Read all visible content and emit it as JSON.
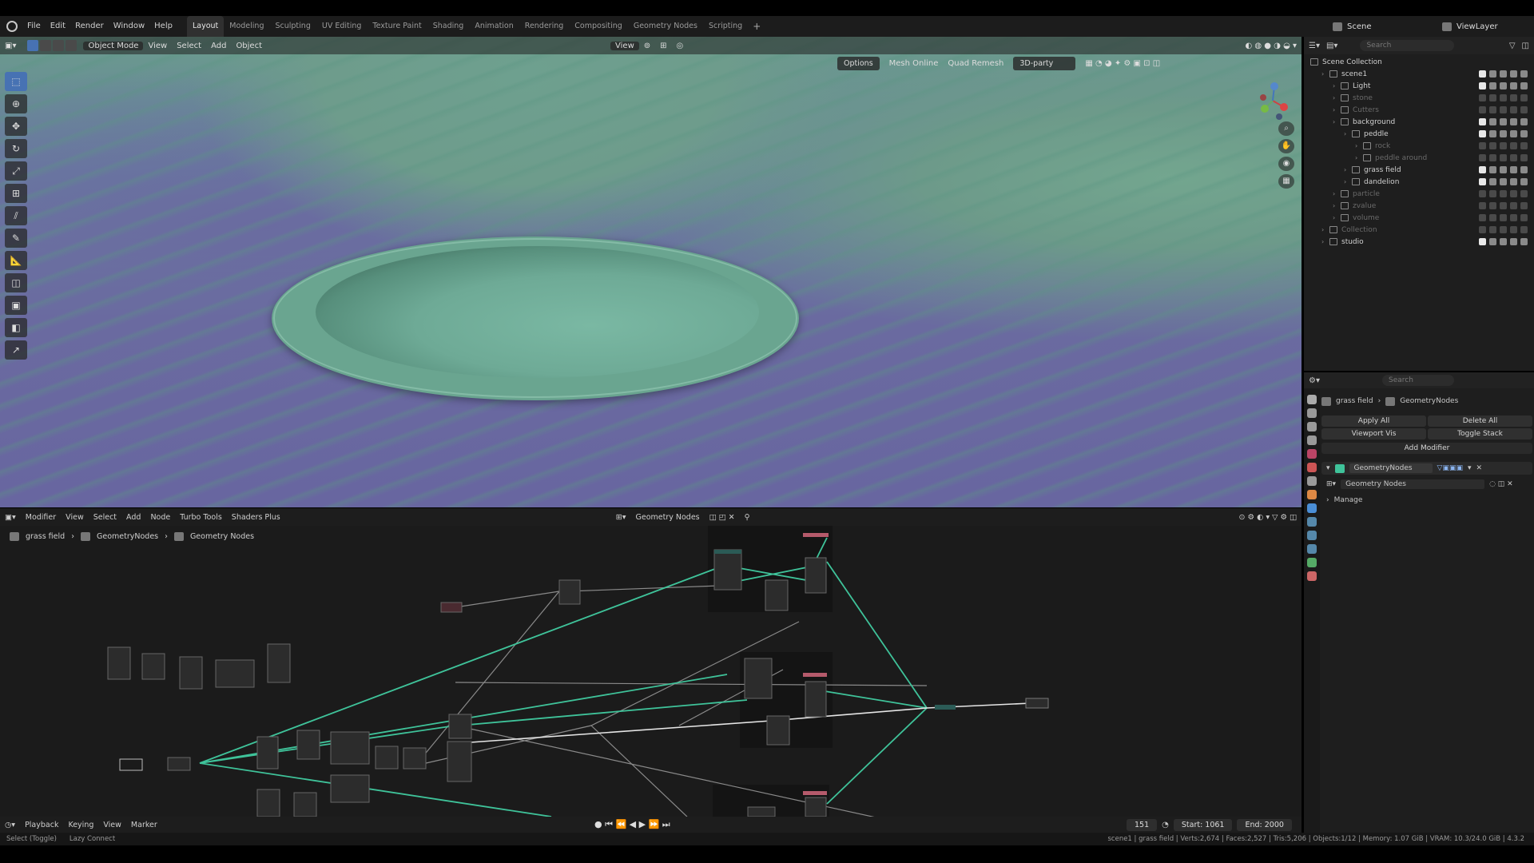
{
  "menubar": {
    "menus": [
      "File",
      "Edit",
      "Render",
      "Window",
      "Help"
    ],
    "workspaces": [
      "Layout",
      "Modeling",
      "Sculpting",
      "UV Editing",
      "Texture Paint",
      "Shading",
      "Animation",
      "Rendering",
      "Compositing",
      "Geometry Nodes",
      "Scripting"
    ],
    "active_workspace": "Layout",
    "scene": "Scene",
    "view_layer": "ViewLayer"
  },
  "viewport": {
    "mode": "Object Mode",
    "menus": [
      "View",
      "Select",
      "Add",
      "Object"
    ],
    "transform_orientation": "View",
    "options": "Options",
    "mesh_online": "Mesh Online",
    "quad_remesh": "Quad Remesh",
    "third_party": "3D-party"
  },
  "outliner": {
    "search_placeholder": "Search",
    "root": "Scene Collection",
    "rows": [
      {
        "label": "scene1",
        "indent": 1,
        "dim": false
      },
      {
        "label": "Light",
        "indent": 2,
        "dim": false
      },
      {
        "label": "stone",
        "indent": 2,
        "dim": true
      },
      {
        "label": "Cutters",
        "indent": 2,
        "dim": true
      },
      {
        "label": "background",
        "indent": 2,
        "dim": false
      },
      {
        "label": "peddle",
        "indent": 3,
        "dim": false
      },
      {
        "label": "rock",
        "indent": 4,
        "dim": true
      },
      {
        "label": "peddle around",
        "indent": 4,
        "dim": true
      },
      {
        "label": "grass field",
        "indent": 3,
        "dim": false
      },
      {
        "label": "dandelion",
        "indent": 3,
        "dim": false
      },
      {
        "label": "particle",
        "indent": 2,
        "dim": true
      },
      {
        "label": "zvalue",
        "indent": 2,
        "dim": true
      },
      {
        "label": "volume",
        "indent": 2,
        "dim": true
      },
      {
        "label": "Collection",
        "indent": 1,
        "dim": true
      },
      {
        "label": "studio",
        "indent": 1,
        "dim": false
      }
    ]
  },
  "properties": {
    "search_placeholder": "Search",
    "object": "grass field",
    "modifier_name": "GeometryNodes",
    "apply_all": "Apply All",
    "delete_all": "Delete All",
    "viewport_vis": "Viewport Vis",
    "toggle_stack": "Toggle Stack",
    "add_modifier": "Add Modifier",
    "node_group": "Geometry Nodes",
    "manage": "Manage"
  },
  "node_editor": {
    "editor_type": "Modifier",
    "menus": [
      "View",
      "Select",
      "Add",
      "Node",
      "Turbo Tools",
      "Shaders Plus"
    ],
    "node_tree": "Geometry Nodes",
    "breadcrumb": [
      "grass field",
      "GeometryNodes",
      "Geometry Nodes"
    ]
  },
  "timeline": {
    "menus": [
      "Playback",
      "Keying",
      "View",
      "Marker"
    ],
    "current_frame": "151",
    "start": "Start: 1061",
    "end": "End: 2000"
  },
  "statusbar": {
    "left1": "Select (Toggle)",
    "left2": "Lazy Connect",
    "right": "scene1 | grass field | Verts:2,674 | Faces:2,527 | Tris:5,206 | Objects:1/12 | Memory: 1.07 GiB | VRAM: 10.3/24.0 GiB | 4.3.2"
  },
  "colors": {
    "accent": "#4772b3",
    "node_link": "#3fc39a",
    "viewport_green": "#6ea08f",
    "viewport_purple": "#6a6aa0"
  }
}
